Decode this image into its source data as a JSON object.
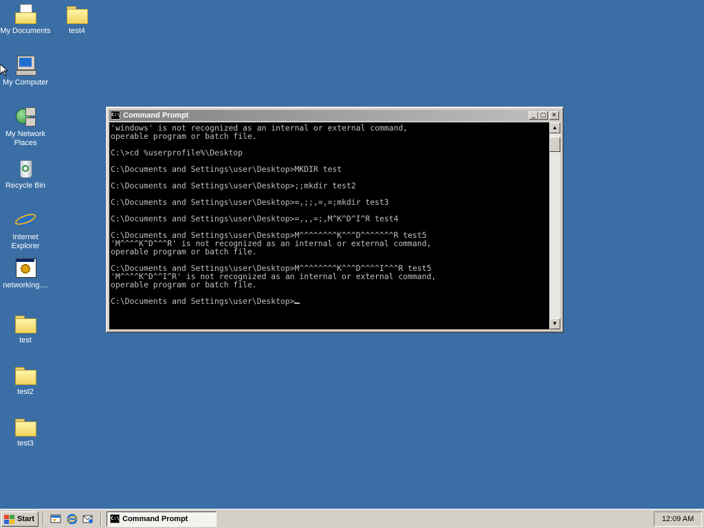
{
  "desktop": {
    "icons": [
      {
        "label": "My Documents",
        "icon": "my-documents-icon"
      },
      {
        "label": "test4",
        "icon": "folder-icon"
      },
      {
        "label": "My Computer",
        "icon": "my-computer-icon"
      },
      {
        "label": "My Network Places",
        "icon": "network-places-icon"
      },
      {
        "label": "Recycle Bin",
        "icon": "recycle-bin-icon"
      },
      {
        "label": "Internet Explorer",
        "icon": "internet-explorer-icon"
      },
      {
        "label": "networking....",
        "icon": "application-icon"
      },
      {
        "label": "test",
        "icon": "folder-icon"
      },
      {
        "label": "test2",
        "icon": "folder-icon"
      },
      {
        "label": "test3",
        "icon": "folder-icon"
      }
    ],
    "background_color": "#3a6ea5"
  },
  "window": {
    "title": "Command Prompt",
    "title_icon_text": "C:\\",
    "controls": {
      "minimize": "_",
      "maximize": "□",
      "close": "✕"
    },
    "console_lines": [
      "'windows' is not recognized as an internal or external command,",
      "operable program or batch file.",
      "",
      "C:\\>cd %userprofile%\\Desktop",
      "",
      "C:\\Documents and Settings\\user\\Desktop>MKDIR test",
      "",
      "C:\\Documents and Settings\\user\\Desktop>;;mkdir test2",
      "",
      "C:\\Documents and Settings\\user\\Desktop>=,;;,=,=;mkdir test3",
      "",
      "C:\\Documents and Settings\\user\\Desktop>=,,,=;,M^K^D^I^R test4",
      "",
      "C:\\Documents and Settings\\user\\Desktop>M^^^^^^^^K^^^D^^^^^^^R test5",
      "'M^^^^K^D^^^R' is not recognized as an internal or external command,",
      "operable program or batch file.",
      "",
      "C:\\Documents and Settings\\user\\Desktop>M^^^^^^^^K^^^D^^^^I^^^R test5",
      "'M^^^^K^D^^I^R' is not recognized as an internal or external command,",
      "operable program or batch file.",
      "",
      "C:\\Documents and Settings\\user\\Desktop>"
    ]
  },
  "taskbar": {
    "start_label": "Start",
    "quick_launch": [
      "show-desktop-icon",
      "internet-explorer-icon",
      "outlook-express-icon"
    ],
    "task_button_label": "Command Prompt",
    "task_icon_text": "C:\\",
    "clock": "12:09 AM"
  }
}
